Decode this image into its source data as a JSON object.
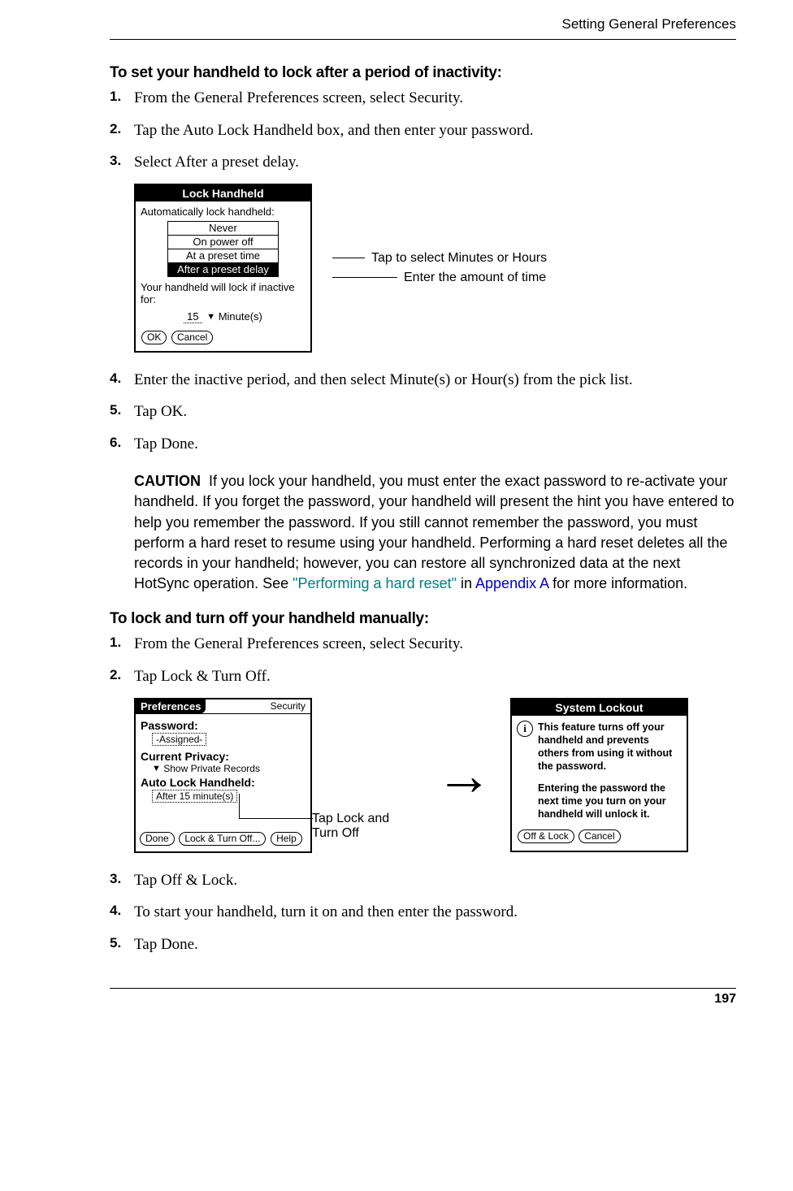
{
  "header": {
    "section": "Setting General Preferences"
  },
  "heading1": "To set your handheld to lock after a period of inactivity:",
  "steps1": [
    "From the General Preferences screen, select Security.",
    "Tap the Auto Lock Handheld box, and then enter your password.",
    "Select After a preset delay."
  ],
  "dialog1": {
    "title": "Lock Handheld",
    "prompt_auto": "Automatically lock handheld:",
    "options": [
      "Never",
      "On power off",
      "At a preset time",
      "After a preset delay"
    ],
    "selected_index": 3,
    "prompt_inactive": "Your handheld will lock if inactive for:",
    "delay_value": "15",
    "delay_unit": "Minute(s)",
    "ok": "OK",
    "cancel": "Cancel"
  },
  "callouts1": {
    "top": "Tap to select Minutes or Hours",
    "bottom": "Enter the amount of time"
  },
  "steps1b": [
    "Enter the inactive period, and then select Minute(s) or Hour(s) from the pick list.",
    "Tap OK.",
    "Tap Done."
  ],
  "caution": {
    "label": "CAUTION",
    "text_pre": "If you lock your handheld, you must enter the exact password to re-activate your handheld. If you forget the password, your handheld will present the hint you have entered to help you remember the password. If you still cannot remember the password, you must perform a hard reset to resume using your handheld. Performing a hard reset deletes all the records in your handheld; however, you can restore all synchronized data at the next HotSync operation. See ",
    "link_hard_reset": "\"Performing a hard reset\"",
    "text_mid": " in ",
    "link_appendix": "Appendix A",
    "text_post": " for more information."
  },
  "heading2": "To lock and turn off your handheld manually:",
  "steps2": [
    "From the General Preferences screen, select Security.",
    "Tap Lock & Turn Off."
  ],
  "prefs": {
    "tab": "Preferences",
    "right": "Security",
    "password_label": "Password:",
    "password_value": "-Assigned-",
    "privacy_label": "Current Privacy:",
    "privacy_value": "Show Private Records",
    "autolock_label": "Auto Lock Handheld:",
    "autolock_value": "After 15 minute(s)",
    "done": "Done",
    "lockoff": "Lock & Turn Off...",
    "help": "Help"
  },
  "callout2": "Tap Lock and Turn Off",
  "lockout": {
    "title": "System Lockout",
    "para1": "This feature turns off your handheld and prevents others from using it without the password.",
    "para2": "Entering the password the next time you turn on your handheld will unlock it.",
    "offlock": "Off & Lock",
    "cancel": "Cancel"
  },
  "steps2b": [
    "Tap Off & Lock.",
    "To start your handheld, turn it on and then enter the password.",
    "Tap Done."
  ],
  "page_number": "197"
}
